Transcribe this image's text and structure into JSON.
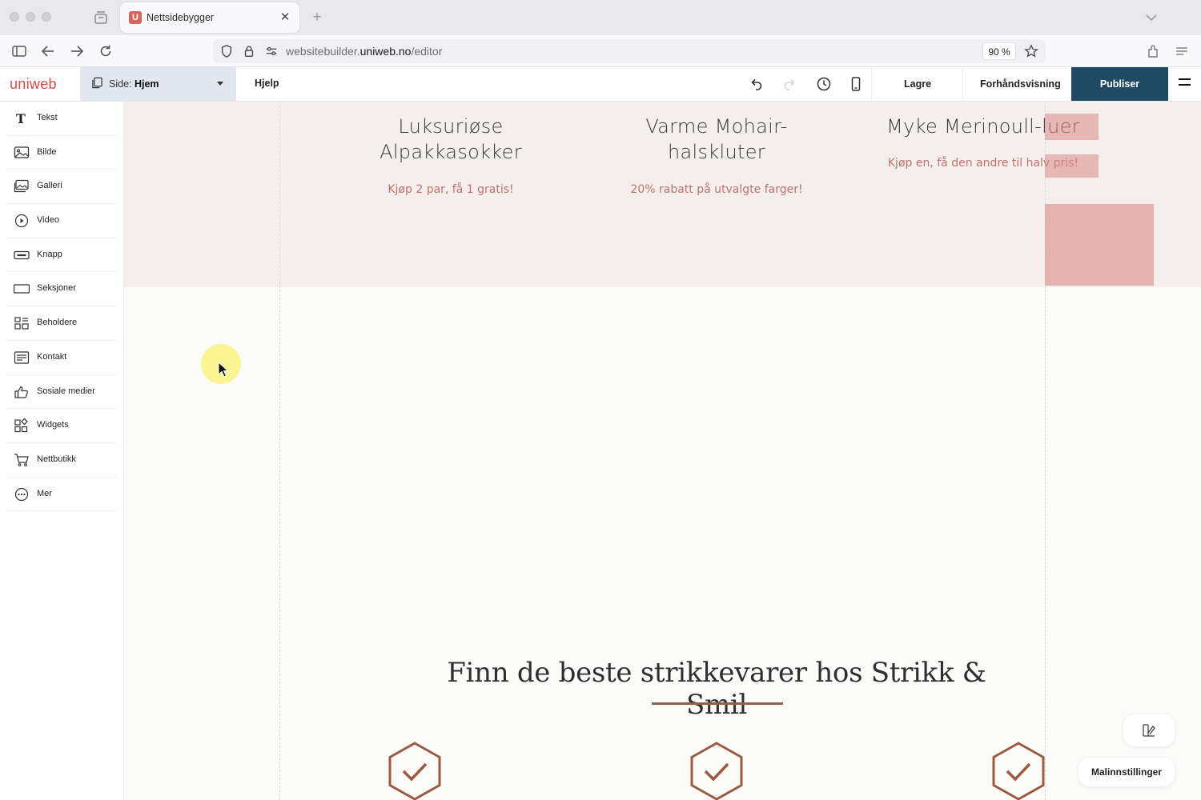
{
  "browser": {
    "tab_title": "Nettsidebygger",
    "tab_favicon_letter": "U",
    "new_tab_label": "+",
    "close_label": "✕",
    "url_prefix": "websitebuilder.",
    "url_domain": "uniweb.no",
    "url_path": "/editor",
    "zoom": "90 %"
  },
  "editor": {
    "logo": "uniweb",
    "page_prefix": "Side:",
    "page_name": "Hjem",
    "help": "Hjelp",
    "save": "Lagre",
    "preview": "Forhåndsvisning",
    "publish": "Publiser",
    "publish_color": "#204a63"
  },
  "sidebar": {
    "items": [
      {
        "label": "Tekst",
        "icon": "text-icon"
      },
      {
        "label": "Bilde",
        "icon": "image-icon"
      },
      {
        "label": "Galleri",
        "icon": "gallery-icon"
      },
      {
        "label": "Video",
        "icon": "play-icon"
      },
      {
        "label": "Knapp",
        "icon": "button-icon"
      },
      {
        "label": "Seksjoner",
        "icon": "section-icon"
      },
      {
        "label": "Beholdere",
        "icon": "container-icon"
      },
      {
        "label": "Kontakt",
        "icon": "form-icon"
      },
      {
        "label": "Sosiale medier",
        "icon": "thumbs-up-icon"
      },
      {
        "label": "Widgets",
        "icon": "widgets-icon"
      },
      {
        "label": "Nettbutikk",
        "icon": "cart-icon"
      },
      {
        "label": "Mer",
        "icon": "more-icon"
      }
    ]
  },
  "canvas": {
    "promos": [
      {
        "title_line1": "Luksuriøse",
        "title_line2": "Alpakkasokker",
        "subtitle": "Kjøp 2 par, få 1 gratis!"
      },
      {
        "title_line1": "Varme Mohair-",
        "title_line2": "halskluter",
        "subtitle": "20% rabatt på utvalgte farger!"
      },
      {
        "title_line1": "Myke Merinoull-luer",
        "title_line2": "",
        "subtitle": "Kjøp en, få den andre til halv pris!"
      }
    ],
    "heading": "Finn de beste strikkevarer hos Strikk & Smil",
    "accent_color": "#9b5a42",
    "subtitle_color": "#c0726c",
    "template_settings": "Malinnstillinger"
  }
}
